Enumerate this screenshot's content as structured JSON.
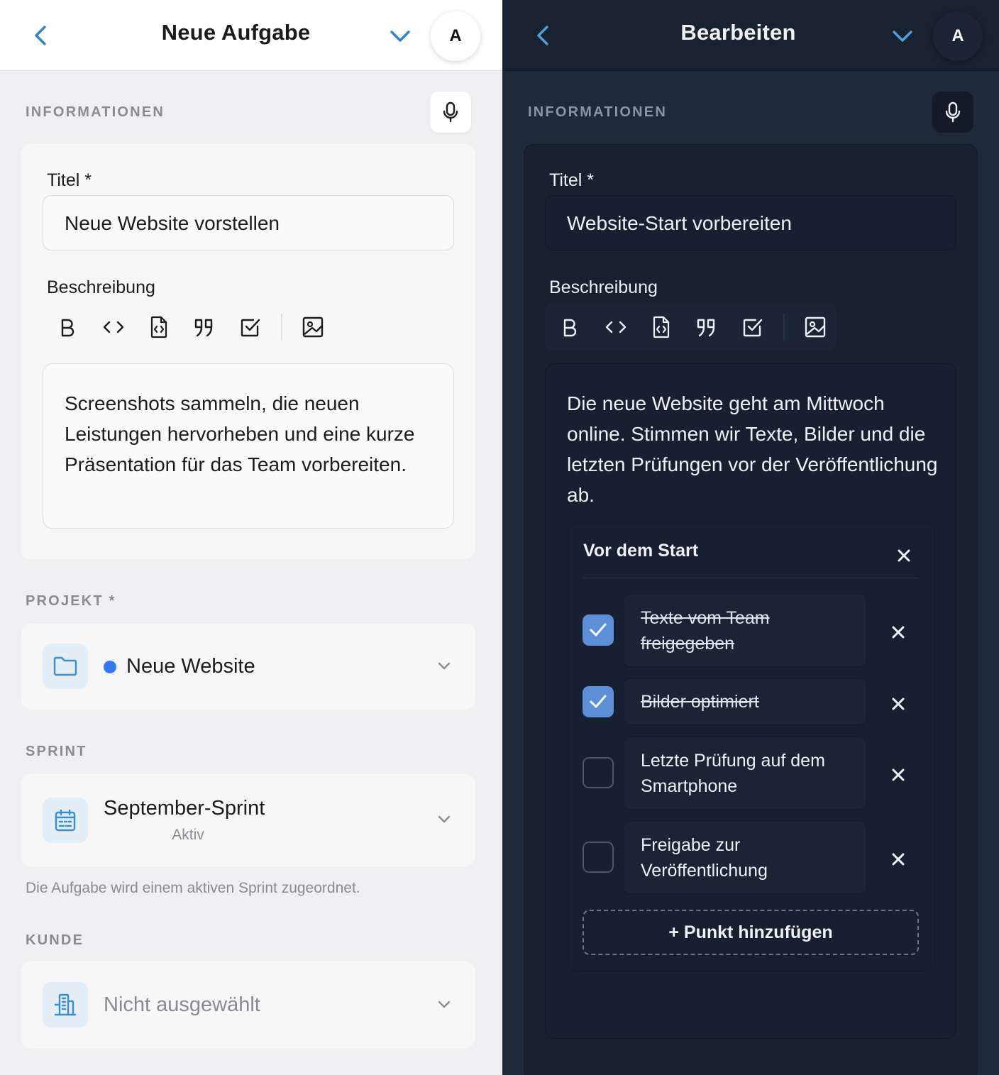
{
  "left": {
    "header": {
      "title": "Neue Aufgabe",
      "avatar": "A",
      "back_icon": "chevron-left-icon",
      "collapse_icon": "chevron-down-icon"
    },
    "section_info": "INFORMATIONEN",
    "mic_icon": "microphone-icon",
    "title_label": "Titel *",
    "title_value": "Neue Website vorstellen",
    "description_label": "Beschreibung",
    "toolbar": [
      "bold-icon",
      "code-icon",
      "code-file-icon",
      "quote-icon",
      "checkbox-icon",
      "image-icon"
    ],
    "description_value": "Screenshots sammeln, die neuen Leistungen hervorheben und eine kurze Präsentation für das Team vorbereiten.",
    "project": {
      "label": "PROJEKT *",
      "value": "Neue Website",
      "dot_color": "#3478f6",
      "icon": "folder-icon"
    },
    "sprint": {
      "label": "SPRINT",
      "value": "September-Sprint",
      "status": "Aktiv",
      "icon": "calendar-icon",
      "hint": "Die Aufgabe wird einem aktiven Sprint zugeordnet."
    },
    "customer": {
      "label": "KUNDE",
      "value": "Nicht ausgewählt",
      "icon": "building-icon"
    }
  },
  "right": {
    "header": {
      "title": "Bearbeiten",
      "avatar": "A",
      "back_icon": "chevron-left-icon",
      "collapse_icon": "chevron-down-icon"
    },
    "section_info": "INFORMATIONEN",
    "mic_icon": "microphone-icon",
    "title_label": "Titel *",
    "title_value": "Website-Start vorbereiten",
    "description_label": "Beschreibung",
    "description_value": "Die neue Website geht am Mittwoch online. Stimmen wir Texte, Bilder und die letzten Prüfungen vor der Veröffentlichung ab.",
    "checklist": {
      "title": "Vor dem Start",
      "items": [
        {
          "text": "Texte vom Team freigegeben",
          "checked": true
        },
        {
          "text": "Bilder optimiert",
          "checked": true
        },
        {
          "text": "Letzte Prüfung auf dem Smartphone",
          "checked": false
        },
        {
          "text": "Freigabe zur Veröffentlichung",
          "checked": false
        }
      ],
      "add_label": "+ Punkt hinzufügen"
    }
  },
  "colors": {
    "accent": "#2a86c9",
    "accent_dark": "#4aa3e0",
    "check": "#5b8fd6"
  }
}
